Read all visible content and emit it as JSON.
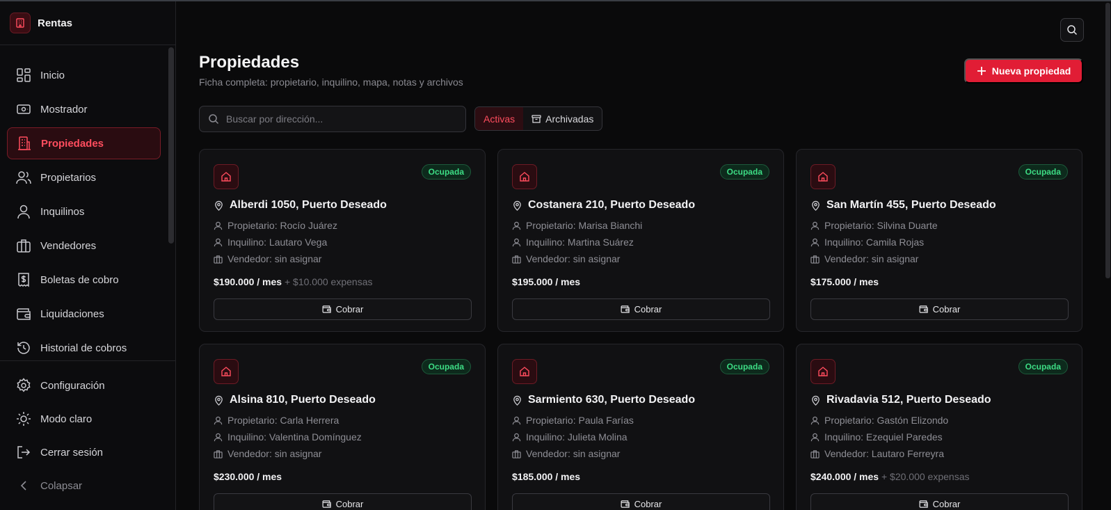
{
  "brand": {
    "name": "Rentas"
  },
  "nav": [
    {
      "label": "Inicio",
      "icon": "dashboard-icon"
    },
    {
      "label": "Mostrador",
      "icon": "cash-icon"
    },
    {
      "label": "Propiedades",
      "icon": "building-icon",
      "active": true
    },
    {
      "label": "Propietarios",
      "icon": "users-icon"
    },
    {
      "label": "Inquilinos",
      "icon": "user-icon"
    },
    {
      "label": "Vendedores",
      "icon": "briefcase-icon"
    },
    {
      "label": "Boletas de cobro",
      "icon": "receipt-icon"
    },
    {
      "label": "Liquidaciones",
      "icon": "wallet-icon"
    },
    {
      "label": "Historial de cobros",
      "icon": "history-icon"
    }
  ],
  "bottom_nav": [
    {
      "label": "Configuración",
      "icon": "gear-icon"
    },
    {
      "label": "Modo claro",
      "icon": "sun-icon"
    },
    {
      "label": "Cerrar sesión",
      "icon": "logout-icon"
    },
    {
      "label": "Colapsar",
      "icon": "chevron-left-icon"
    }
  ],
  "header": {
    "title": "Propiedades",
    "subtitle": "Ficha completa: propietario, inquilino, mapa, notas y archivos",
    "new_button": "Nueva propiedad"
  },
  "search": {
    "placeholder": "Buscar por dirección...",
    "value": ""
  },
  "filters": {
    "active": "Activas",
    "archived": "Archivadas"
  },
  "colors": {
    "accent": "#e11d35",
    "success": "#3ddc84",
    "background": "#0a0a0b"
  },
  "properties": [
    {
      "address": "Alberdi 1050, Puerto Deseado",
      "status": "Ocupada",
      "owner": "Propietario: Rocío Juárez",
      "tenant": "Inquilino: Lautaro Vega",
      "seller": "Vendedor: sin asignar",
      "price": "$190.000 / mes",
      "expenses": "+ $10.000 expensas",
      "action": "Cobrar"
    },
    {
      "address": "Costanera 210, Puerto Deseado",
      "status": "Ocupada",
      "owner": "Propietario: Marisa Bianchi",
      "tenant": "Inquilino: Martina Suárez",
      "seller": "Vendedor: sin asignar",
      "price": "$195.000 / mes",
      "expenses": "",
      "action": "Cobrar"
    },
    {
      "address": "San Martín 455, Puerto Deseado",
      "status": "Ocupada",
      "owner": "Propietario: Silvina Duarte",
      "tenant": "Inquilino: Camila Rojas",
      "seller": "Vendedor: sin asignar",
      "price": "$175.000 / mes",
      "expenses": "",
      "action": "Cobrar"
    },
    {
      "address": "Alsina 810, Puerto Deseado",
      "status": "Ocupada",
      "owner": "Propietario: Carla Herrera",
      "tenant": "Inquilino: Valentina Domínguez",
      "seller": "Vendedor: sin asignar",
      "price": "$230.000 / mes",
      "expenses": "",
      "action": "Cobrar"
    },
    {
      "address": "Sarmiento 630, Puerto Deseado",
      "status": "Ocupada",
      "owner": "Propietario: Paula Farías",
      "tenant": "Inquilino: Julieta Molina",
      "seller": "Vendedor: sin asignar",
      "price": "$185.000 / mes",
      "expenses": "",
      "action": "Cobrar"
    },
    {
      "address": "Rivadavia 512, Puerto Deseado",
      "status": "Ocupada",
      "owner": "Propietario: Gastón Elizondo",
      "tenant": "Inquilino: Ezequiel Paredes",
      "seller": "Vendedor: Lautaro Ferreyra",
      "price": "$240.000 / mes",
      "expenses": "+ $20.000 expensas",
      "action": "Cobrar"
    }
  ]
}
